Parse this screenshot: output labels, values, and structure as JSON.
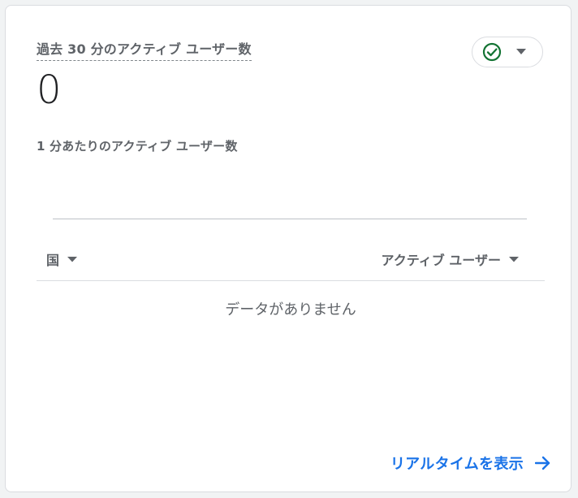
{
  "card": {
    "metric_title": "過去 30 分のアクティブ ユーザー数",
    "metric_value": "0",
    "subtitle": "1 分あたりのアクティブ ユーザー数",
    "status_icon": "check-circle-icon",
    "colors": {
      "status_green": "#137333",
      "link_blue": "#1a73e8",
      "muted_text": "#5f6368"
    }
  },
  "table": {
    "columns": [
      {
        "label": "国"
      },
      {
        "label": "アクティブ ユーザー"
      }
    ],
    "empty_message": "データがありません"
  },
  "footer": {
    "link_label": "リアルタイムを表示",
    "link_icon": "arrow-forward-icon"
  }
}
